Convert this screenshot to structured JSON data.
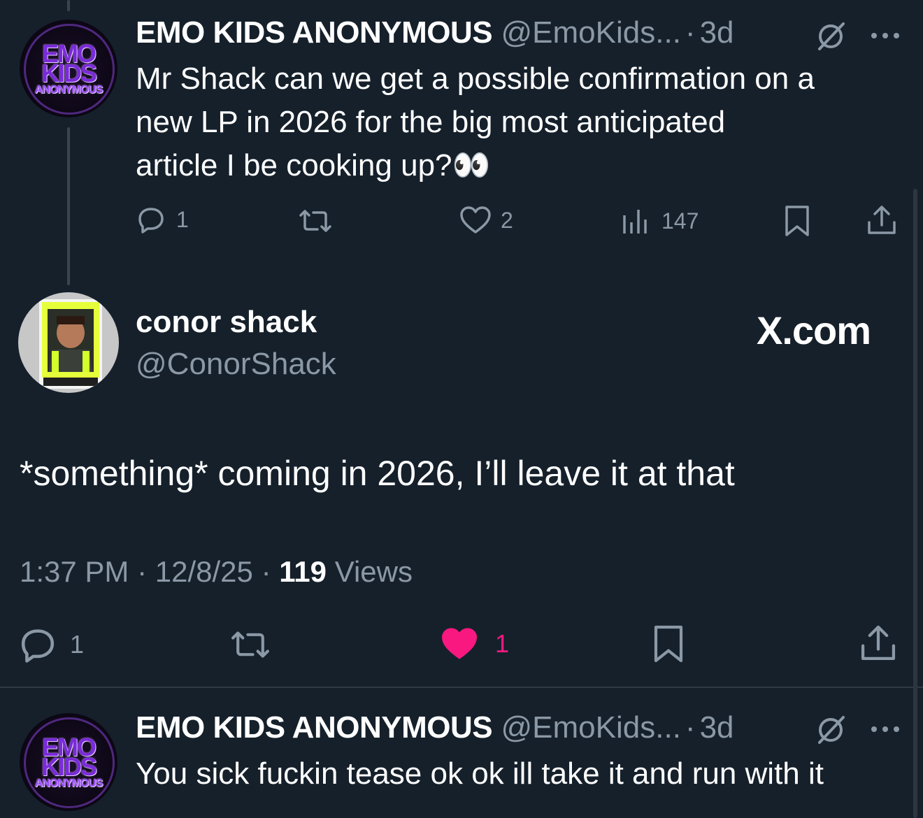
{
  "tweet1": {
    "avatar_text": [
      "EMO",
      "KIDS",
      "ANONYMOUS"
    ],
    "name": "EMO KIDS ANONYMOUS",
    "handle": "@EmoKids...",
    "dot": "·",
    "time": "3d",
    "text_lines": [
      "Mr Shack can we get a possible confirmation on a",
      "new LP in 2026 for the big most anticipated",
      "article I be cooking up?👀"
    ],
    "replies": "1",
    "likes": "2",
    "views": "147"
  },
  "tweet2": {
    "name": "conor shack",
    "handle": "@ConorShack",
    "brand": "X.com",
    "text": "*something* coming in 2026, I’ll leave it at that",
    "time": "1:37 PM",
    "date": "12/8/25",
    "sep": "·",
    "views_count": "119",
    "views_label": "Views",
    "replies": "1",
    "likes": "1",
    "like_color": "#f91880"
  },
  "tweet3": {
    "avatar_text": [
      "EMO",
      "KIDS",
      "ANONYMOUS"
    ],
    "name": "EMO KIDS ANONYMOUS",
    "handle": "@EmoKids...",
    "dot": "·",
    "time": "3d",
    "text": "You sick fuckin tease ok ok ill take it and run with it"
  },
  "icons": [
    "reply-icon",
    "retweet-icon",
    "like-icon",
    "views-icon",
    "bookmark-icon",
    "share-icon",
    "grok-icon",
    "more-icon"
  ]
}
